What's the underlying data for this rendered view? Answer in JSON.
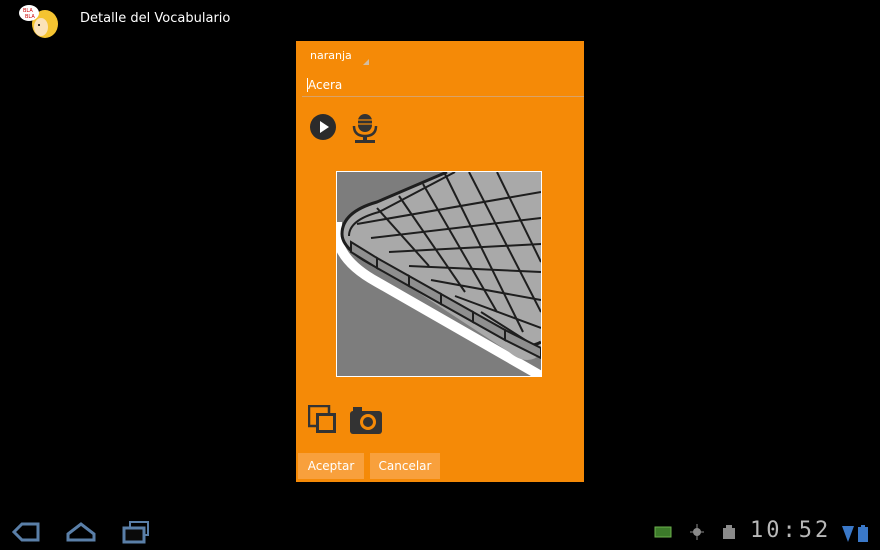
{
  "action_bar": {
    "app_icon": "bla-bla-girl-icon",
    "title": "Detalle del Vocabulario"
  },
  "dialog": {
    "category": {
      "selected": "naranja"
    },
    "word_input": {
      "value": "Acera"
    },
    "icons": [
      "play-icon",
      "microphone-icon",
      "gallery-icon",
      "camera-icon"
    ],
    "picture": "sidewalk-curb-image",
    "buttons": {
      "accept": "Aceptar",
      "cancel": "Cancelar"
    },
    "accent_color": "#F58A07"
  },
  "system_bar": {
    "nav_icons": [
      "back-icon",
      "home-icon",
      "recent-apps-icon"
    ],
    "status_icons": [
      "usb-icon",
      "debug-icon",
      "storage-icon",
      "wifi-icon",
      "battery-icon"
    ],
    "clock": "10:52"
  }
}
